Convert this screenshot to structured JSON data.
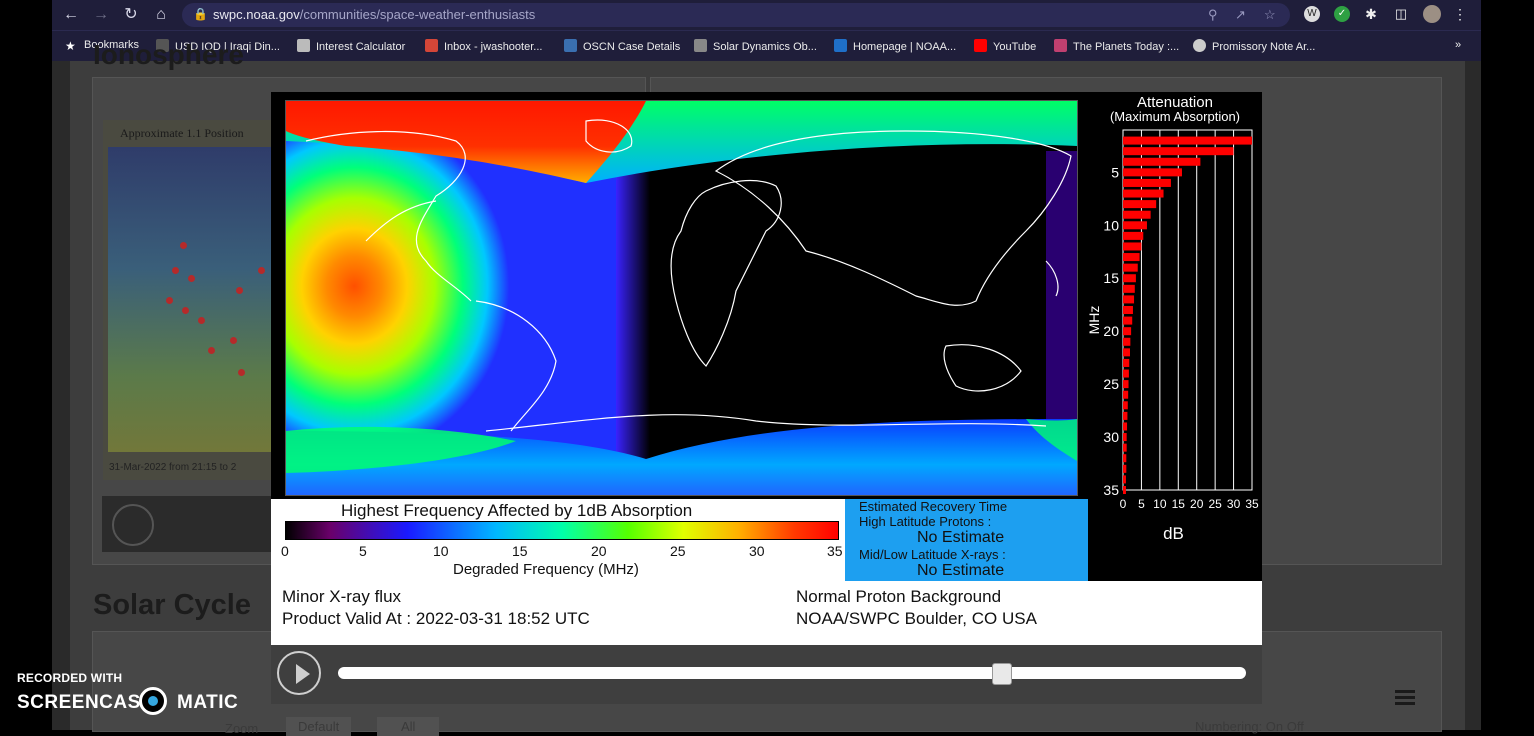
{
  "browser": {
    "url_host": "swpc.noaa.gov",
    "url_path": "/communities/space-weather-enthusiasts",
    "bookmarks": [
      {
        "label": "Bookmarks",
        "icon": "star-icon",
        "color": "#ffffff"
      },
      {
        "label": "USD IQD | Iraqi Din...",
        "icon": "inv-icon",
        "color": "#555555"
      },
      {
        "label": "Interest Calculator",
        "icon": "grid-icon",
        "color": "#bbbbbb"
      },
      {
        "label": "Inbox - jwashooter...",
        "icon": "gmail-icon",
        "color": "#d44638"
      },
      {
        "label": "OSCN Case Details",
        "icon": "shield-icon",
        "color": "#3a6fb0"
      },
      {
        "label": "Solar Dynamics Ob...",
        "icon": "sdo-icon",
        "color": "#888888"
      },
      {
        "label": "Homepage | NOAA...",
        "icon": "noaa-icon",
        "color": "#1f6fc8"
      },
      {
        "label": "YouTube",
        "icon": "youtube-icon",
        "color": "#ff0000"
      },
      {
        "label": "The Planets Today :...",
        "icon": "planets-icon",
        "color": "#c04070"
      },
      {
        "label": "Promissory Note Ar...",
        "icon": "globe-icon",
        "color": "#cccccc"
      }
    ],
    "more_bookmarks": "»"
  },
  "background_page": {
    "section_partial": "Ionosphere",
    "old_map_caption": "Approximate 1.1 Position",
    "old_map_footer": "31-Mar-2022 from 21:15 to 2",
    "solar_cycle": "Solar Cycle",
    "bottom_tabs": [
      "Zoom",
      "Default",
      "All",
      "Numbering: On Off"
    ]
  },
  "modal": {
    "attenuation": {
      "title": "Attenuation",
      "subtitle": "(Maximum Absorption)",
      "ylabel": "MHz",
      "xlabel": "dB",
      "yticks": [
        "5",
        "10",
        "15",
        "20",
        "25",
        "30",
        "35"
      ],
      "xticks": [
        "0",
        "5",
        "10",
        "15",
        "20",
        "25",
        "30",
        "35"
      ],
      "bar_color": "#ff0000"
    },
    "colorbar": {
      "title": "Highest Frequency Affected by 1dB Absorption",
      "ticks": [
        "0",
        "5",
        "10",
        "15",
        "20",
        "25",
        "30",
        "35"
      ],
      "xlabel": "Degraded Frequency (MHz)"
    },
    "recovery": {
      "title": "Estimated Recovery Time",
      "high_label": "High Latitude Protons :",
      "high_value": "No Estimate",
      "mid_label": "Mid/Low Latitude X-rays :",
      "mid_value": "No Estimate"
    },
    "footer": {
      "flux": "Minor X-ray flux",
      "valid": "Product Valid At : 2022-03-31 18:52 UTC",
      "proton": "Normal Proton Background",
      "origin": "NOAA/SWPC Boulder, CO USA"
    },
    "player": {
      "progress": 0.73
    }
  },
  "watermark": {
    "line1": "RECORDED WITH",
    "brand_left": "SCREENCAST",
    "brand_right": "MATIC"
  },
  "chart_data": {
    "type": "bar",
    "title": "Attenuation",
    "subtitle": "(Maximum Absorption)",
    "orientation": "horizontal",
    "xlabel": "dB",
    "ylabel": "MHz",
    "xlim": [
      0,
      35
    ],
    "ylim": [
      1,
      35
    ],
    "categories": [
      2,
      3,
      4,
      5,
      6,
      7,
      8,
      9,
      10,
      11,
      12,
      13,
      14,
      15,
      16,
      17,
      18,
      19,
      20,
      21,
      22,
      23,
      24,
      25,
      26,
      27,
      28,
      29,
      30,
      31,
      32,
      33,
      34,
      35
    ],
    "values": [
      36.0,
      30.0,
      21.0,
      16.0,
      13.0,
      11.0,
      9.0,
      7.5,
      6.5,
      5.5,
      5.0,
      4.5,
      4.0,
      3.5,
      3.2,
      3.0,
      2.7,
      2.5,
      2.2,
      2.0,
      1.9,
      1.7,
      1.6,
      1.5,
      1.4,
      1.3,
      1.2,
      1.1,
      1.0,
      1.0,
      0.9,
      0.9,
      0.8,
      0.8
    ]
  }
}
